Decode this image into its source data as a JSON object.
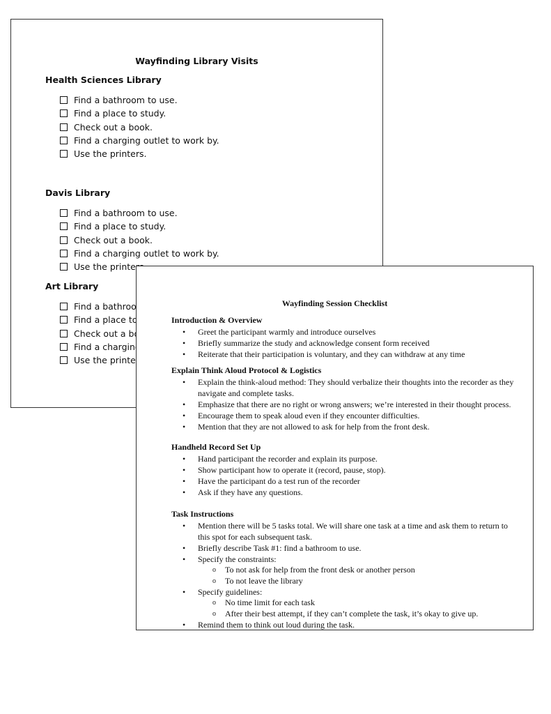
{
  "back_page": {
    "title": "Wayfinding Library Visits",
    "sections": [
      {
        "heading": "Health Sciences Library",
        "items": [
          "Find a bathroom to use.",
          "Find a place to study.",
          "Check out a book.",
          "Find a charging outlet to work by.",
          "Use the printers."
        ]
      },
      {
        "heading": "Davis Library",
        "items": [
          "Find a bathroom to use.",
          "Find a place to study.",
          "Check out a book.",
          "Find a charging outlet to work by.",
          "Use the printers."
        ]
      },
      {
        "heading": "Art Library",
        "items": [
          "Find a bathroom to use.",
          "Find a place to study.",
          "Check out a book.",
          "Find a charging outlet to work by.",
          "Use the printers."
        ]
      }
    ]
  },
  "front_page": {
    "title": "Wayfinding Session Checklist",
    "sections": [
      {
        "heading": "Introduction & Overview",
        "items": [
          {
            "text": "Greet the participant warmly and introduce ourselves"
          },
          {
            "text": "Briefly summarize the study and acknowledge consent form received"
          },
          {
            "text": "Reiterate that their participation is voluntary, and they can withdraw at any time"
          }
        ]
      },
      {
        "heading": "Explain Think Aloud Protocol & Logistics",
        "items": [
          {
            "text": "Explain the think-aloud method: They should verbalize their thoughts into the recorder as they navigate and complete tasks."
          },
          {
            "text": "Emphasize that there are no right or wrong answers; we’re interested in their thought process."
          },
          {
            "text": "Encourage them to speak aloud even if they encounter difficulties."
          },
          {
            "text": "Mention that they are not allowed to ask for help from the front desk."
          }
        ]
      },
      {
        "heading": "Handheld Record Set Up",
        "items": [
          {
            "text": "Hand participant the recorder and explain its purpose."
          },
          {
            "text": "Show participant how to operate it (record, pause, stop)."
          },
          {
            "text": "Have the participant do a test run of the recorder"
          },
          {
            "text": "Ask if they have any questions."
          }
        ]
      },
      {
        "heading": "Task Instructions",
        "items": [
          {
            "text": "Mention there will be 5 tasks total. We will share one task at a time and ask them to return to this spot for each subsequent task."
          },
          {
            "text": "Briefly describe Task #1: find a bathroom to use."
          },
          {
            "text": "Specify the constraints:",
            "sub": [
              "To not ask for help from the front desk or another person",
              "To not leave the library"
            ]
          },
          {
            "text": "Specify guidelines:",
            "sub": [
              "No time limit for each task",
              "After their best attempt, if they can’t complete the task, it’s okay to give up."
            ]
          },
          {
            "text": "Remind them to think out loud during the task."
          }
        ]
      }
    ]
  }
}
